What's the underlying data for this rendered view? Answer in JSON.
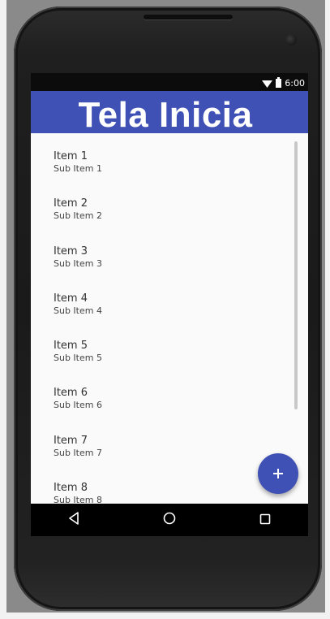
{
  "statusbar": {
    "time": "6:00",
    "icons": [
      "wifi-icon",
      "battery-icon"
    ]
  },
  "appbar": {
    "title": "Tela Inicia",
    "color": "#3f51b5"
  },
  "list": {
    "items": [
      {
        "title": "Item 1",
        "subtitle": "Sub Item 1"
      },
      {
        "title": "Item 2",
        "subtitle": "Sub Item 2"
      },
      {
        "title": "Item 3",
        "subtitle": "Sub Item 3"
      },
      {
        "title": "Item 4",
        "subtitle": "Sub Item 4"
      },
      {
        "title": "Item 5",
        "subtitle": "Sub Item 5"
      },
      {
        "title": "Item 6",
        "subtitle": "Sub Item 6"
      },
      {
        "title": "Item 7",
        "subtitle": "Sub Item 7"
      },
      {
        "title": "Item 8",
        "subtitle": "Sub Item 8"
      }
    ]
  },
  "fab": {
    "icon": "plus-icon",
    "color": "#3f51b5"
  },
  "navbar": {
    "buttons": [
      "back-icon",
      "home-icon",
      "recents-icon"
    ]
  }
}
